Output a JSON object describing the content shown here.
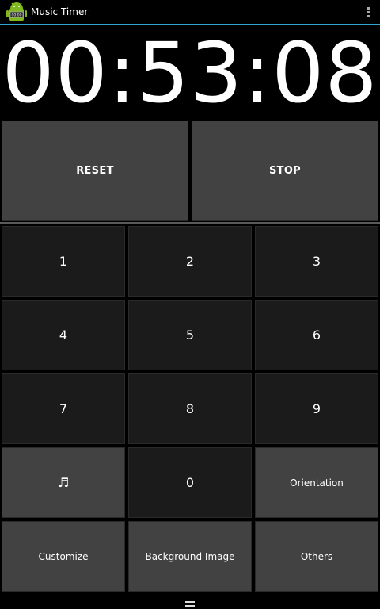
{
  "app": {
    "title": "Music Timer",
    "icon": "android-clock-icon"
  },
  "timer": {
    "display": "00:53:08"
  },
  "controls": {
    "reset_label": "RESET",
    "stop_label": "STOP"
  },
  "keypad": {
    "k1": "1",
    "k2": "2",
    "k3": "3",
    "k4": "4",
    "k5": "5",
    "k6": "6",
    "k7": "7",
    "k8": "8",
    "k9": "9",
    "music": "♬",
    "k0": "0",
    "orientation": "Orientation"
  },
  "bottom": {
    "customize": "Customize",
    "background_image": "Background Image",
    "others": "Others"
  },
  "colors": {
    "accent": "#33a5cf",
    "button_light": "#424242",
    "button_dark": "#1b1b1b",
    "background": "#000000"
  }
}
